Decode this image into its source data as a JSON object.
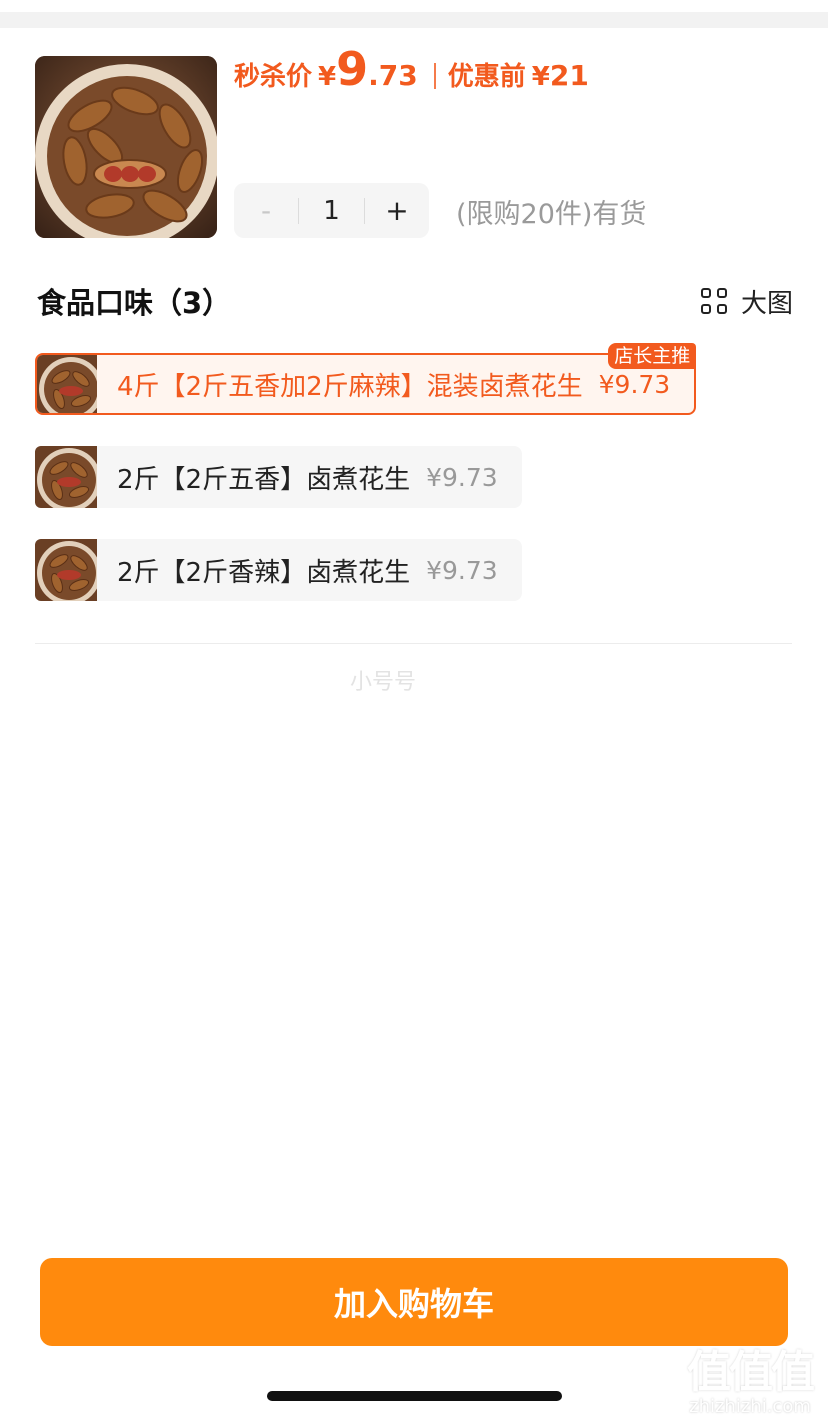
{
  "product": {
    "price_label": "秒杀价",
    "yen": "¥",
    "price_int": "9",
    "price_dec": ".73",
    "orig_label": "优惠前",
    "orig_yen": "¥",
    "orig_value": "21",
    "accent_color": "#f25a1e",
    "image_icon": "peanut-bowl-photo"
  },
  "stepper": {
    "minus": "-",
    "qty": "1",
    "plus": "+",
    "limit_text": "(限购20件)有货"
  },
  "section": {
    "title": "食品口味（3）",
    "bigview_label": "大图",
    "bigview_icon": "grid-icon"
  },
  "options": [
    {
      "label": "4斤【2斤五香加2斤麻辣】混装卤煮花生",
      "price": "¥9.73",
      "badge": "店长主推",
      "selected": true
    },
    {
      "label": "2斤【2斤五香】卤煮花生",
      "price": "¥9.73",
      "selected": false
    },
    {
      "label": "2斤【2斤香辣】卤煮花生",
      "price": "¥9.73",
      "selected": false
    }
  ],
  "watermark": "小号号",
  "cart_button": {
    "label": "加入购物车",
    "color": "#ff8a0d"
  },
  "site_mark": {
    "glyphs": "值值值",
    "domain": "zhizhizhi.com"
  }
}
